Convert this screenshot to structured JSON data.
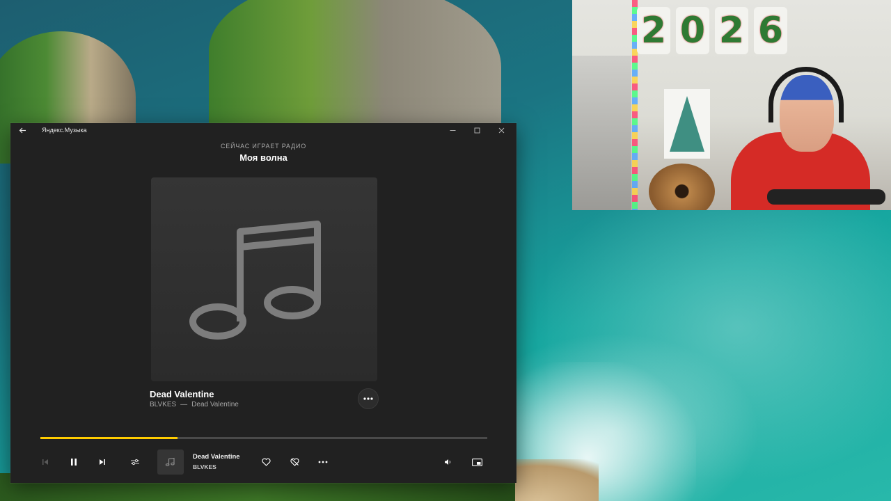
{
  "app": {
    "title": "Яндекс.Музыка",
    "now_playing_label": "СЕЙЧАС ИГРАЕТ РАДИО",
    "station": "Моя волна"
  },
  "track": {
    "title": "Dead Valentine",
    "artist": "BLVKES",
    "separator": "—",
    "album": "Dead Valentine"
  },
  "player": {
    "progress_fraction": 0.307,
    "mini_title": "Dead Valentine",
    "mini_artist": "BLVKES"
  },
  "webcam": {
    "year_digits": [
      "2",
      "0",
      "2",
      "6"
    ]
  },
  "icons": {
    "back": "arrow-left-icon",
    "minimize": "minimize-icon",
    "maximize": "maximize-icon",
    "close": "close-icon",
    "cover": "music-note-icon",
    "more": "more-dots-icon",
    "previous": "previous-track-icon",
    "pause": "pause-icon",
    "next": "next-track-icon",
    "settings": "equalizer-settings-icon",
    "like": "heart-icon",
    "dislike": "heart-crossed-icon",
    "volume": "volume-icon",
    "mini_player": "picture-in-picture-icon"
  },
  "colors": {
    "accent": "#ffcc00",
    "window_bg": "#212121"
  }
}
